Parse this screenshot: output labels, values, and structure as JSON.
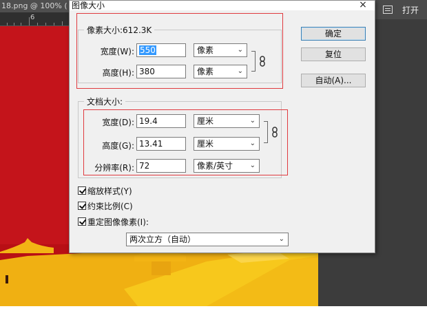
{
  "background": {
    "doc_tab": "18.png @ 100% (",
    "ruler_mark": "6",
    "open_label": "打开"
  },
  "dialog": {
    "title": "图像大小",
    "close_glyph": "×",
    "pixel_size": {
      "title": "像素大小:612.3K",
      "width_label": "宽度(W):",
      "width_value": "550",
      "width_unit": "像素",
      "height_label": "高度(H):",
      "height_value": "380",
      "height_unit": "像素"
    },
    "doc_size": {
      "title": "文档大小:",
      "width_label": "宽度(D):",
      "width_value": "19.4",
      "width_unit": "厘米",
      "height_label": "高度(G):",
      "height_value": "13.41",
      "height_unit": "厘米",
      "res_label": "分辨率(R):",
      "res_value": "72",
      "res_unit": "像素/英寸"
    },
    "buttons": {
      "ok": "确定",
      "reset": "复位",
      "auto": "自动(A)..."
    },
    "options": {
      "scale_styles": "缩放样式(Y)",
      "constrain": "约束比例(C)",
      "resample": "重定图像像素(I):",
      "resample_method": "两次立方（自动）"
    }
  },
  "colors": {
    "canvas_red": "#c4141b",
    "highlight_red": "#e0393e",
    "selection_blue": "#3399ff",
    "default_button_border": "#3c7fb1"
  }
}
